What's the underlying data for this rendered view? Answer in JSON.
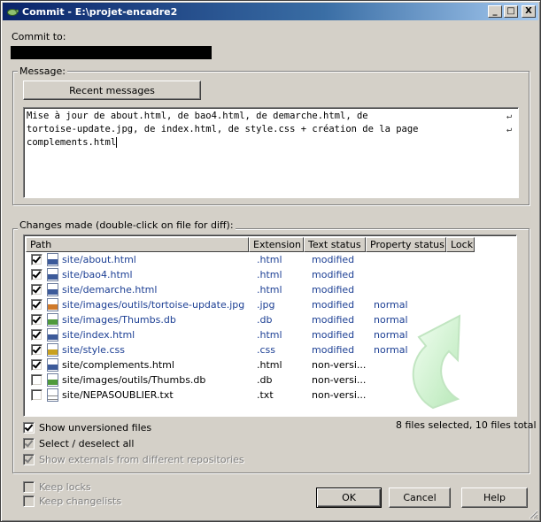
{
  "window": {
    "title": "Commit - E:\\projet-encadre2",
    "controls": {
      "minimize": "_",
      "maximize": "□",
      "close": "X"
    }
  },
  "commit_to": {
    "label": "Commit to:"
  },
  "message": {
    "group_label": "Message:",
    "recent_button": "Recent messages",
    "lines": [
      "Mise à jour de about.html, de bao4.html, de demarche.html, de",
      "tortoise-update.jpg, de index.html, de style.css + création de la page",
      "complements.html"
    ],
    "wrap_mark": "↵"
  },
  "changes": {
    "group_label": "Changes made (double-click on file for diff):",
    "columns": [
      "Path",
      "Extension",
      "Text status",
      "Property status",
      "Lock"
    ],
    "rows": [
      {
        "checked": true,
        "icon": "html-file-icon",
        "path": "site/about.html",
        "ext": ".html",
        "text_status": "modified",
        "prop_status": ""
      },
      {
        "checked": true,
        "icon": "html-file-icon",
        "path": "site/bao4.html",
        "ext": ".html",
        "text_status": "modified",
        "prop_status": ""
      },
      {
        "checked": true,
        "icon": "html-file-icon",
        "path": "site/demarche.html",
        "ext": ".html",
        "text_status": "modified",
        "prop_status": ""
      },
      {
        "checked": true,
        "icon": "image-file-icon",
        "path": "site/images/outils/tortoise-update.jpg",
        "ext": ".jpg",
        "text_status": "modified",
        "prop_status": "normal"
      },
      {
        "checked": true,
        "icon": "db-file-icon",
        "path": "site/images/Thumbs.db",
        "ext": ".db",
        "text_status": "modified",
        "prop_status": "normal"
      },
      {
        "checked": true,
        "icon": "html-file-icon",
        "path": "site/index.html",
        "ext": ".html",
        "text_status": "modified",
        "prop_status": "normal"
      },
      {
        "checked": true,
        "icon": "css-file-icon",
        "path": "site/style.css",
        "ext": ".css",
        "text_status": "modified",
        "prop_status": "normal"
      },
      {
        "checked": true,
        "icon": "html-file-icon",
        "path": "site/complements.html",
        "ext": ".html",
        "text_status": "non-versi...",
        "prop_status": ""
      },
      {
        "checked": false,
        "icon": "db-file-icon",
        "path": "site/images/outils/Thumbs.db",
        "ext": ".db",
        "text_status": "non-versi...",
        "prop_status": ""
      },
      {
        "checked": false,
        "icon": "text-file-icon",
        "path": "site/NEPASOUBLIER.txt",
        "ext": ".txt",
        "text_status": "non-versi...",
        "prop_status": ""
      }
    ],
    "summary": "8 files selected, 10 files total"
  },
  "options": {
    "show_unversioned": "Show unversioned files",
    "select_deselect": "Select / deselect all",
    "show_externals": "Show externals from different repositories",
    "keep_locks": "Keep locks",
    "keep_changelists": "Keep changelists"
  },
  "buttons": {
    "ok": "OK",
    "cancel": "Cancel",
    "help": "Help"
  },
  "colors": {
    "title_start": "#0a246a",
    "title_end": "#a6caf0",
    "link_blue": "#1c3f94",
    "face": "#d4d0c8"
  }
}
